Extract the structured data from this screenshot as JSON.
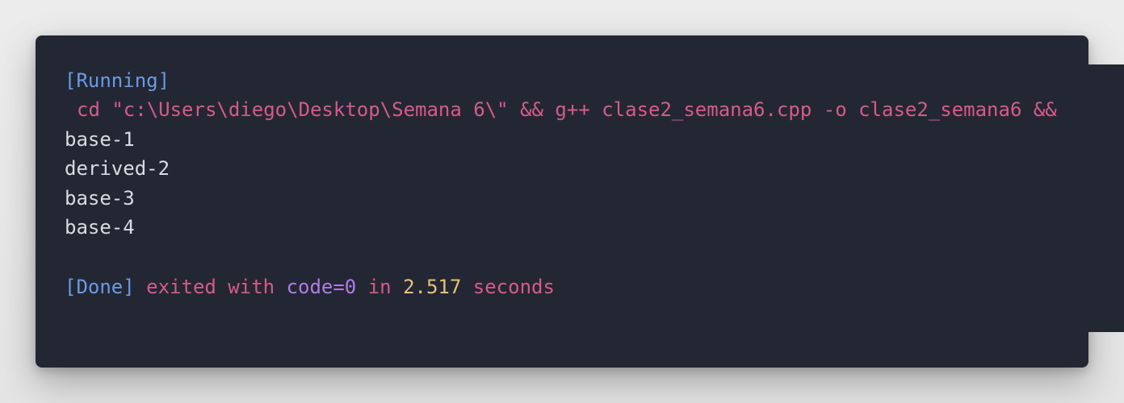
{
  "colors": {
    "background": "#e8e8e8",
    "panel": "#232733",
    "output_text": "#d8dbe4",
    "status_blue": "#6a9ae4",
    "status_pink": "#d65a8c",
    "status_purple": "#b07be8",
    "status_yellow": "#e7c177"
  },
  "output": {
    "running_label": "[Running]",
    "command": "cd \"c:\\Users\\diego\\Desktop\\Semana 6\\\" && g++ clase2_semana6.cpp -o clase2_semana6 &&",
    "lines": [
      "base-1",
      "derived-2",
      "base-3",
      "base-4"
    ],
    "done": {
      "label": "[Done]",
      "exited_text": "exited with",
      "code_text": "code=0",
      "in_text": "in",
      "duration": "2.517",
      "seconds_text": "seconds"
    }
  }
}
